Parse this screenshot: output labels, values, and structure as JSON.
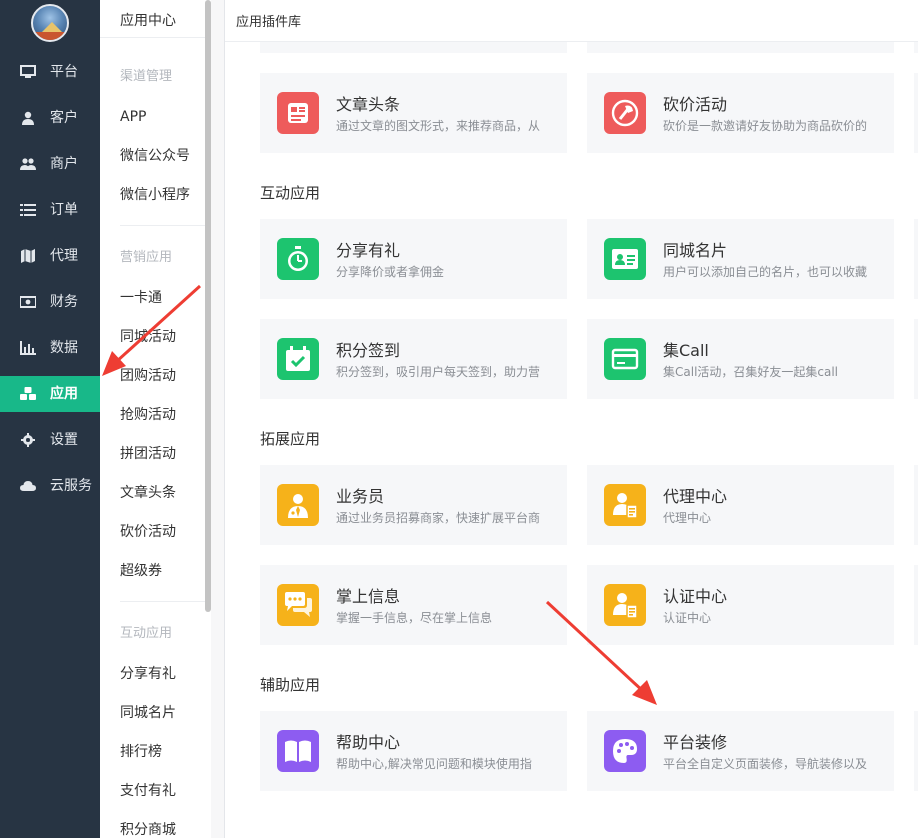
{
  "nav": {
    "items": [
      {
        "label": "平台",
        "icon": "monitor-icon"
      },
      {
        "label": "客户",
        "icon": "user-icon"
      },
      {
        "label": "商户",
        "icon": "users-icon"
      },
      {
        "label": "订单",
        "icon": "list-icon"
      },
      {
        "label": "代理",
        "icon": "map-icon"
      },
      {
        "label": "财务",
        "icon": "money-icon"
      },
      {
        "label": "数据",
        "icon": "bar-chart-icon"
      },
      {
        "label": "应用",
        "icon": "cubes-icon",
        "active": true
      },
      {
        "label": "设置",
        "icon": "gear-icon"
      },
      {
        "label": "云服务",
        "icon": "cloud-icon"
      }
    ]
  },
  "sub": {
    "header": "应用中心",
    "groups": [
      {
        "title": "渠道管理",
        "items": [
          "APP",
          "微信公众号",
          "微信小程序"
        ]
      },
      {
        "title": "营销应用",
        "items": [
          "一卡通",
          "同城活动",
          "团购活动",
          "抢购活动",
          "拼团活动",
          "文章头条",
          "砍价活动",
          "超级券"
        ]
      },
      {
        "title": "互动应用",
        "items": [
          "分享有礼",
          "同城名片",
          "排行榜",
          "支付有礼",
          "积分商城"
        ]
      }
    ]
  },
  "main": {
    "header": "应用插件库",
    "top_cards": [
      {
        "title": "文章头条",
        "desc": "通过文章的图文形式，来推荐商品，从",
        "color": "#ee5b5b",
        "icon": "article-icon"
      },
      {
        "title": "砍价活动",
        "desc": "砍价是一款邀请好友协助为商品砍价的",
        "color": "#ee5b5b",
        "icon": "axe-icon"
      }
    ],
    "sections": [
      {
        "title": "互动应用",
        "cards": [
          {
            "title": "分享有礼",
            "desc": "分享降价或者拿佣金",
            "color": "#1dc46f",
            "icon": "stopwatch-icon"
          },
          {
            "title": "同城名片",
            "desc": "用户可以添加自己的名片，也可以收藏",
            "color": "#1dc46f",
            "icon": "id-card-icon"
          },
          {
            "title": "积分签到",
            "desc": "积分签到，吸引用户每天签到，助力营",
            "color": "#1dc46f",
            "icon": "calendar-check-icon"
          },
          {
            "title": "集Call",
            "desc": "集Call活动，召集好友一起集call",
            "color": "#1dc46f",
            "icon": "card-icon"
          }
        ]
      },
      {
        "title": "拓展应用",
        "cards": [
          {
            "title": "业务员",
            "desc": "通过业务员招募商家，快速扩展平台商",
            "color": "#f6b21a",
            "icon": "salesman-icon"
          },
          {
            "title": "代理中心",
            "desc": "代理中心",
            "color": "#f6b21a",
            "icon": "agent-icon"
          },
          {
            "title": "掌上信息",
            "desc": "掌握一手信息，尽在掌上信息",
            "color": "#f6b21a",
            "icon": "chat-icon"
          },
          {
            "title": "认证中心",
            "desc": "认证中心",
            "color": "#f6b21a",
            "icon": "certified-user-icon"
          }
        ]
      },
      {
        "title": "辅助应用",
        "cards": [
          {
            "title": "帮助中心",
            "desc": "帮助中心,解决常见问题和模块使用指",
            "color": "#8d5cf1",
            "icon": "book-icon"
          },
          {
            "title": "平台装修",
            "desc": "平台全自定义页面装修，导航装修以及",
            "color": "#8d5cf1",
            "icon": "palette-icon"
          }
        ]
      }
    ]
  },
  "colors": {
    "sidebar": "#273443",
    "active": "#18b889",
    "arrow": "#ee3d33"
  }
}
